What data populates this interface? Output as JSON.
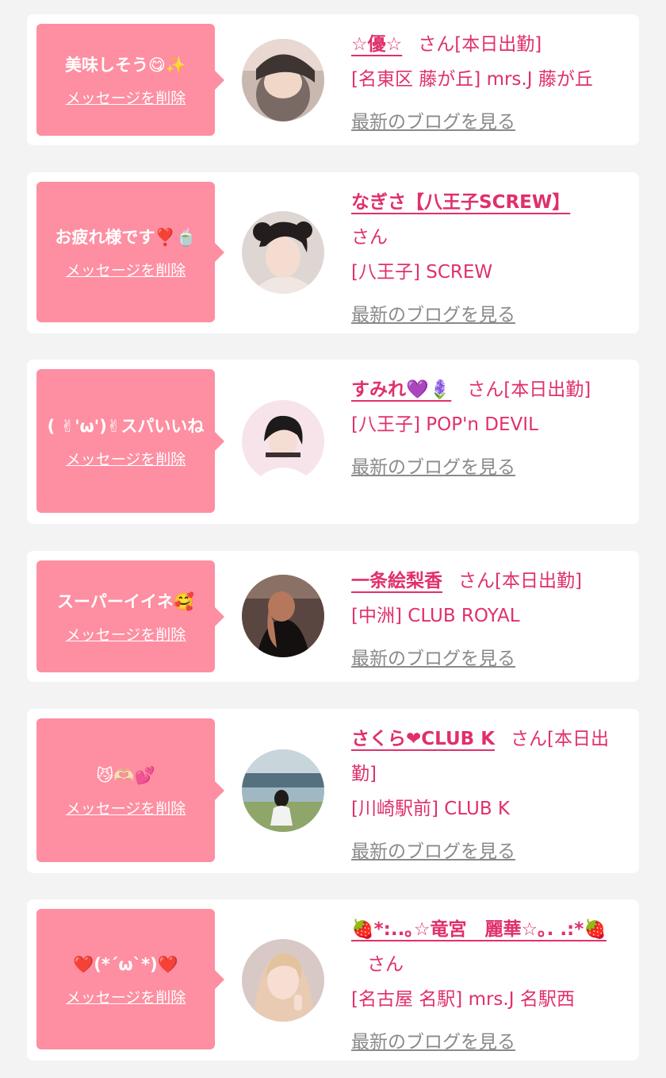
{
  "colors": {
    "accent": "#e0306a",
    "bubble": "#fe8ea1",
    "link_gray": "#8a8a8a",
    "background": "#f3f3f3"
  },
  "common": {
    "delete_label": "メッセージを削除",
    "blog_label": "最新のブログを見る",
    "san_label": "さん"
  },
  "entries": [
    {
      "message": "美味しそう😋✨",
      "name": "☆優☆",
      "status": "[本日出勤]",
      "shop": "[名東区 藤が丘] mrs.J 藤が丘"
    },
    {
      "message": "お疲れ様です❣️🍵",
      "name": "なぎさ【八王子SCREW】",
      "status": "",
      "shop": "[八王子] SCREW"
    },
    {
      "message": "( ✌︎'ω')✌︎スパいいね",
      "name": "すみれ💜🪻",
      "status": "[本日出勤]",
      "shop": "[八王子] POP'n DEVIL"
    },
    {
      "message": "スーパーイイネ🥰",
      "name": "一条絵梨香",
      "status": "[本日出勤]",
      "shop": "[中洲] CLUB ROYAL"
    },
    {
      "message": "😼🫶🏻💕",
      "name": "さくら❤CLUB K",
      "status": "[本日出勤]",
      "shop": "[川崎駅前] CLUB K"
    },
    {
      "message": "❤️(*´ω`*)❤️",
      "name": "🍓*:..｡☆竜宮　麗華☆｡. .:*🍓",
      "status": "",
      "shop": "[名古屋 名駅] mrs.J 名駅西"
    }
  ]
}
